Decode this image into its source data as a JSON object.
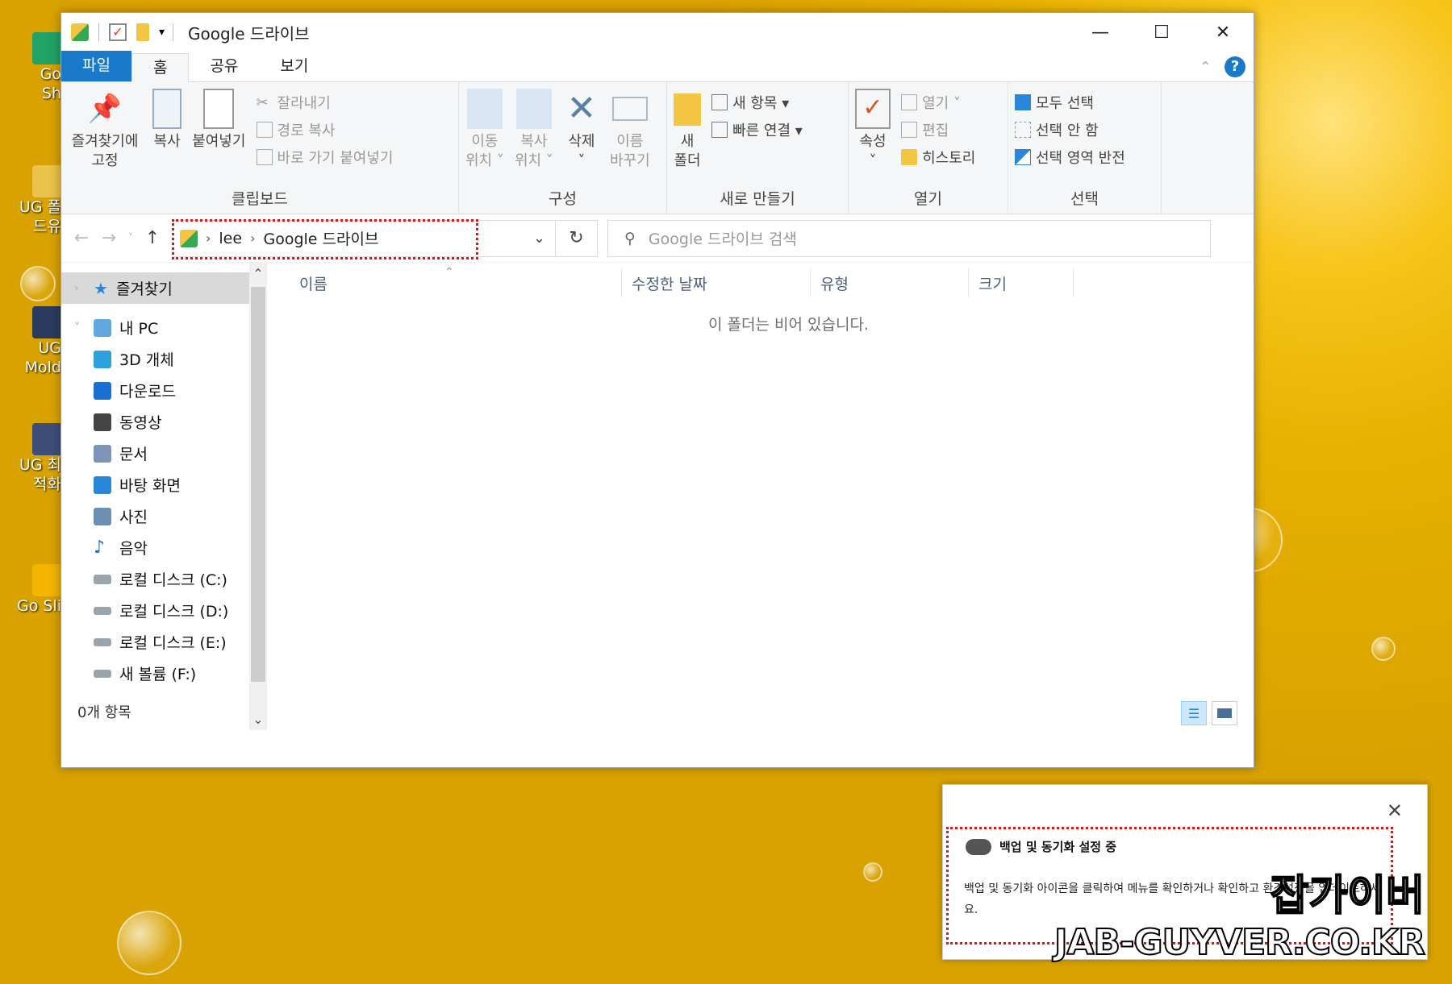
{
  "window": {
    "title": "Google 드라이브",
    "controls": {
      "minimize": "—",
      "maximize": "☐",
      "close": "✕"
    }
  },
  "ribbon_tabs": [
    {
      "label": "파일"
    },
    {
      "label": "홈"
    },
    {
      "label": "공유"
    },
    {
      "label": "보기"
    }
  ],
  "help": "?",
  "ribbon": {
    "clipboard": {
      "label": "클립보드",
      "pin": "즐겨찾기에\n고정",
      "copy": "복사",
      "paste": "붙여넣기",
      "cut": "잘라내기",
      "copy_path": "경로 복사",
      "paste_shortcut": "바로 가기 붙여넣기"
    },
    "organize": {
      "label": "구성",
      "move_to": "이동\n위치 ˅",
      "copy_to": "복사\n위치 ˅",
      "delete": "삭제\n˅",
      "rename": "이름\n바꾸기"
    },
    "new": {
      "label": "새로 만들기",
      "new_folder": "새\n폴더",
      "new_item": "새 항목 ▾",
      "easy_access": "빠른 연결 ▾"
    },
    "open": {
      "label": "열기",
      "properties": "속성\n˅",
      "open": "열기 ˅",
      "edit": "편집",
      "history": "히스토리"
    },
    "select": {
      "label": "선택",
      "select_all": "모두 선택",
      "select_none": "선택 안 함",
      "invert": "선택 영역 반전"
    }
  },
  "address": {
    "crumbs": [
      "lee",
      "Google 드라이브"
    ],
    "search_placeholder": "Google 드라이브 검색"
  },
  "nav_pane": {
    "favorites": "즐겨찾기",
    "this_pc": "내 PC",
    "items": [
      {
        "label": "3D 개체",
        "icon": "3d-objects-icon",
        "color": "#2ea0db"
      },
      {
        "label": "다운로드",
        "icon": "download-icon",
        "color": "#1a6fd0"
      },
      {
        "label": "동영상",
        "icon": "video-icon",
        "color": "#444444"
      },
      {
        "label": "문서",
        "icon": "documents-icon",
        "color": "#7b94b8"
      },
      {
        "label": "바탕 화면",
        "icon": "desktop-icon",
        "color": "#2a86d6"
      },
      {
        "label": "사진",
        "icon": "pictures-icon",
        "color": "#6b8fb3"
      },
      {
        "label": "음악",
        "icon": "music-icon",
        "color": "#1a6fd0"
      },
      {
        "label": "로컬 디스크 (C:)",
        "icon": "drive-c-icon",
        "color": "#9aa4ad"
      },
      {
        "label": "로컬 디스크 (D:)",
        "icon": "drive-icon",
        "color": "#9aa4ad"
      },
      {
        "label": "로컬 디스크 (E:)",
        "icon": "drive-icon",
        "color": "#9aa4ad"
      },
      {
        "label": "새 볼륨 (F:)",
        "icon": "drive-icon",
        "color": "#9aa4ad"
      }
    ]
  },
  "columns": [
    "이름",
    "수정한 날짜",
    "유형",
    "크기"
  ],
  "empty_message": "이 폴더는 비어 있습니다.",
  "status": {
    "item_count": "0개 항목"
  },
  "toast": {
    "title": "백업 및 동기화 설정 중",
    "body": "백업 및 동기화 아이콘을 클릭하여 메뉴를 확인하거나 확인하고 환경설정을 업데이트하세요.",
    "close": "✕"
  },
  "watermark": {
    "korean": "잡가이버",
    "url": "JAB-GUYVER.CO.KR"
  },
  "desktop_icons": [
    "Go Sh",
    "UG 폴드유",
    "UG Mold",
    "UG 최적화",
    "Go Sli"
  ],
  "colors": {
    "accent": "#1979ca",
    "highlight_dots": "#d11a1a",
    "background": "#f2b705"
  }
}
